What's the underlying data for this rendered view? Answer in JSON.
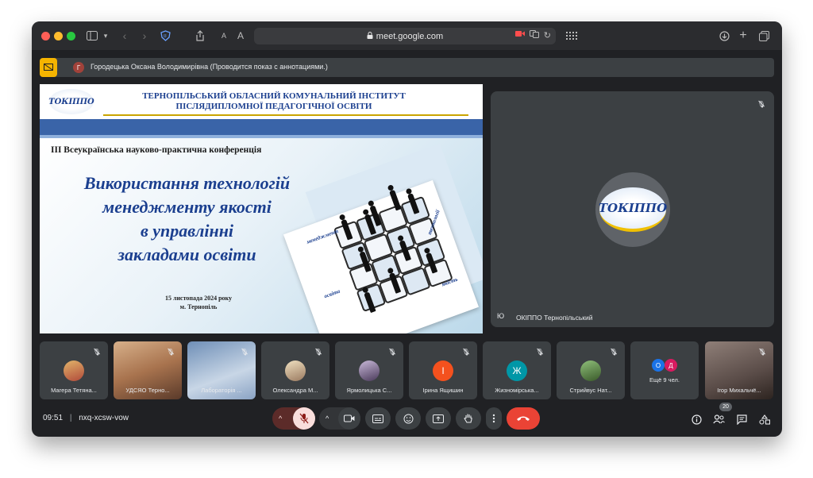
{
  "browser": {
    "url": "meet.google.com",
    "reader_small": "A",
    "reader_large": "A"
  },
  "presenter_bar": {
    "avatar_letter": "Г",
    "text": "Городецька Оксана Володимирівна (Проводится показ с аннотациями.)"
  },
  "slide": {
    "logo": "ТОКІППО",
    "institution_line1": "ТЕРНОПІЛЬСЬКИЙ ОБЛАСНИЙ КОМУНАЛЬНИЙ ІНСТИТУТ",
    "institution_line2": "ПІСЛЯДИПЛОМНОЇ ПЕДАГОГІЧНОЇ ОСВІТИ",
    "conference": "ІІІ Всеукраїнська науково-практична конференція",
    "title_lines": [
      "Використання технологій",
      "менеджменту якості",
      "в управлінні",
      "закладами освіти"
    ],
    "date_line1": "15 листопада 2024 року",
    "date_line2": "м. Тернопіль",
    "puzzle_words": [
      "менеджмент",
      "технології",
      "освіта",
      "якість"
    ]
  },
  "main_tile": {
    "logo": "ТОКІППО",
    "name": "ОКІППО Тернопільський",
    "indicator": "Ю"
  },
  "participants": [
    {
      "name": "Магера Тетяна..."
    },
    {
      "name": "УДСЯО Терно..."
    },
    {
      "name": "Лабораторія ..."
    },
    {
      "name": "Олександра М..."
    },
    {
      "name": "Ярмолицька С..."
    },
    {
      "name": "Ірина Ящишин",
      "letter": "І"
    },
    {
      "name": "Жизномірська...",
      "letter": "Ж"
    },
    {
      "name": "Стрийвус Нат..."
    },
    {
      "name": "Ещё 9 чел.",
      "letters": [
        "О",
        "Д"
      ]
    },
    {
      "name": "Ігор Михальчё..."
    }
  ],
  "bottom": {
    "time": "09:51",
    "separator": "|",
    "meeting_code": "nxq-xcsw-vow",
    "participants_count": "20"
  },
  "colors": {
    "background": "#202124",
    "tile": "#3c4043",
    "end_call": "#ea4335",
    "presenter_badge": "#f5b400"
  }
}
